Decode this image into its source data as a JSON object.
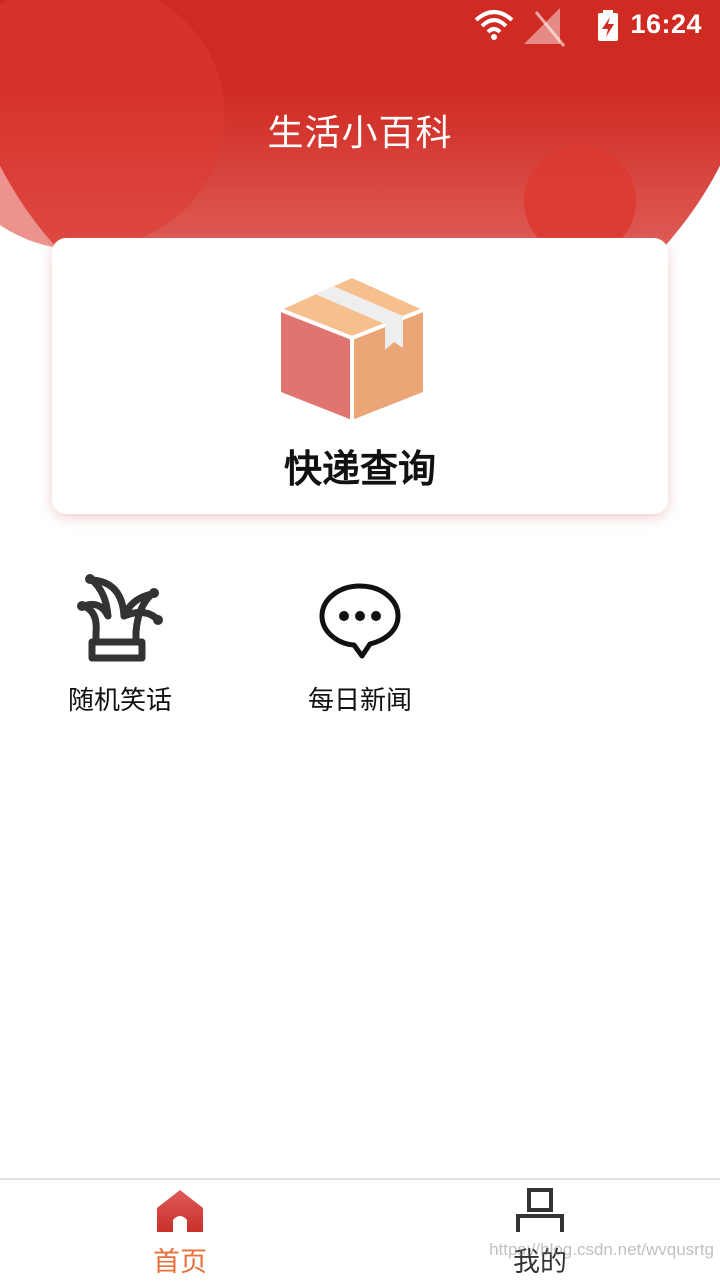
{
  "status_bar": {
    "time": "16:24",
    "icons": [
      "wifi-icon",
      "no-signal-icon",
      "battery-charging-icon"
    ]
  },
  "header": {
    "title": "生活小百科",
    "color": "#cf2b22"
  },
  "card": {
    "label": "快递查询",
    "icon": "package-box-icon"
  },
  "features": [
    {
      "label": "随机笑话",
      "icon": "jester-hat-icon"
    },
    {
      "label": "每日新闻",
      "icon": "chat-bubble-icon"
    }
  ],
  "bottom_nav": {
    "items": [
      {
        "label": "首页",
        "icon": "home-icon",
        "active": true,
        "color": "#e8703a"
      },
      {
        "label": "我的",
        "icon": "profile-icon",
        "active": false,
        "color": "#333333"
      }
    ]
  },
  "watermark": "https://blog.csdn.net/wvqusrtg"
}
